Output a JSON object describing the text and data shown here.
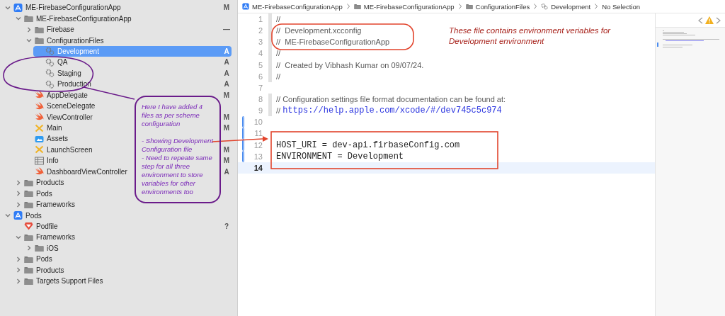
{
  "navigator": {
    "items": [
      {
        "kind": "project",
        "label": "ME-FirebaseConfigurationApp",
        "badge": "M",
        "expanded": true,
        "selected": false,
        "children": [
          {
            "kind": "folder",
            "label": "ME-FirebaseConfigurationApp",
            "expanded": true,
            "selected": false,
            "children": [
              {
                "kind": "folder",
                "label": "Firebase",
                "badge": "—",
                "expanded": false,
                "selected": false
              },
              {
                "kind": "folder",
                "label": "ConfigurationFiles",
                "expanded": true,
                "selected": false,
                "children": [
                  {
                    "kind": "config",
                    "label": "Development",
                    "badge": "A",
                    "selected": true
                  },
                  {
                    "kind": "config",
                    "label": "QA",
                    "badge": "A",
                    "selected": false
                  },
                  {
                    "kind": "config",
                    "label": "Staging",
                    "badge": "A",
                    "selected": false
                  },
                  {
                    "kind": "config",
                    "label": "Production",
                    "badge": "A",
                    "selected": false
                  }
                ]
              },
              {
                "kind": "swift",
                "label": "AppDelegate",
                "badge": "M",
                "selected": false
              },
              {
                "kind": "swift",
                "label": "SceneDelegate",
                "selected": false
              },
              {
                "kind": "swift",
                "label": "ViewController",
                "badge": "M",
                "selected": false
              },
              {
                "kind": "storyboard",
                "label": "Main",
                "badge": "M",
                "selected": false
              },
              {
                "kind": "assets",
                "label": "Assets",
                "selected": false
              },
              {
                "kind": "storyboard",
                "label": "LaunchScreen",
                "badge": "M",
                "selected": false
              },
              {
                "kind": "plist",
                "label": "Info",
                "badge": "M",
                "selected": false
              },
              {
                "kind": "swift",
                "label": "DashboardViewController",
                "badge": "A",
                "selected": false
              }
            ]
          },
          {
            "kind": "folder",
            "label": "Products",
            "expanded": false,
            "selected": false
          },
          {
            "kind": "folder",
            "label": "Pods",
            "expanded": false,
            "selected": false
          },
          {
            "kind": "folder",
            "label": "Frameworks",
            "expanded": false,
            "selected": false
          }
        ]
      },
      {
        "kind": "project",
        "label": "Pods",
        "expanded": true,
        "selected": false,
        "children": [
          {
            "kind": "podfile",
            "label": "Podfile",
            "badge": "?",
            "selected": false
          },
          {
            "kind": "folder",
            "label": "Frameworks",
            "expanded": true,
            "selected": false,
            "children": [
              {
                "kind": "folder",
                "label": "iOS",
                "expanded": false,
                "selected": false
              }
            ]
          },
          {
            "kind": "folder",
            "label": "Pods",
            "expanded": false,
            "selected": false
          },
          {
            "kind": "folder",
            "label": "Products",
            "expanded": false,
            "selected": false
          },
          {
            "kind": "folder",
            "label": "Targets Support Files",
            "expanded": false,
            "selected": false
          }
        ]
      }
    ]
  },
  "breadcrumbs": [
    {
      "kind": "project",
      "label": "ME-FirebaseConfigurationApp"
    },
    {
      "kind": "folder",
      "label": "ME-FirebaseConfigurationApp"
    },
    {
      "kind": "folder",
      "label": "ConfigurationFiles"
    },
    {
      "kind": "config",
      "label": "Development"
    },
    {
      "kind": "none",
      "label": "No Selection"
    }
  ],
  "editor": {
    "lines": [
      {
        "number": "1",
        "kind": "comment",
        "text": "//",
        "changed": false,
        "current": false
      },
      {
        "number": "2",
        "kind": "comment",
        "text": "//  Development.xcconfig",
        "changed": false,
        "current": false
      },
      {
        "number": "3",
        "kind": "comment",
        "text": "//  ME-FirebaseConfigurationApp",
        "changed": false,
        "current": false
      },
      {
        "number": "4",
        "kind": "comment",
        "text": "//",
        "changed": false,
        "current": false
      },
      {
        "number": "5",
        "kind": "comment",
        "text": "//  Created by Vibhash Kumar on 09/07/24.",
        "changed": false,
        "current": false
      },
      {
        "number": "6",
        "kind": "comment",
        "text": "//",
        "changed": false,
        "current": false
      },
      {
        "number": "7",
        "kind": "blank",
        "changed": false,
        "current": false
      },
      {
        "number": "8",
        "kind": "comment",
        "text": "// Configuration settings file format documentation can be found at:",
        "changed": false,
        "current": false
      },
      {
        "number": "9",
        "kind": "link",
        "text": "//",
        "link": "https://help.apple.com/xcode/#/dev745c5c974",
        "changed": false,
        "current": false
      },
      {
        "number": "10",
        "kind": "blank",
        "changed": true,
        "current": false
      },
      {
        "number": "11",
        "kind": "blank",
        "changed": true,
        "current": false
      },
      {
        "number": "12",
        "kind": "code",
        "text": "HOST_URI = dev-api.firbaseConfig.com",
        "changed": true,
        "current": false
      },
      {
        "number": "13",
        "kind": "code",
        "text": "ENVIRONMENT = Development",
        "changed": true,
        "current": false
      },
      {
        "number": "14",
        "kind": "blank",
        "changed": false,
        "current": true
      }
    ]
  },
  "annotations": {
    "callout": [
      "Here I have added  4 files as per scheme configuration",
      "- Showing Development Configuration file\n- Need to repeate same step for all three environment to store variables for other environments too"
    ],
    "note": "These file contains environment veriables for Development environment"
  }
}
